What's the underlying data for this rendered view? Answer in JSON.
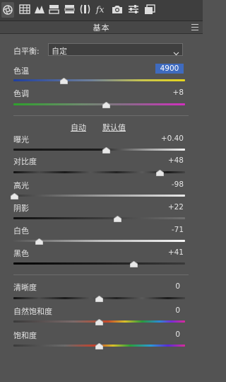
{
  "toolbar": {
    "icons": [
      "aperture-icon",
      "grid-icon",
      "curve-icon",
      "split-panel-icon",
      "toning-icon",
      "lens-icon",
      "fx-icon",
      "camera-icon",
      "sliders-icon",
      "presets-icon"
    ]
  },
  "panel": {
    "title": "基本"
  },
  "white_balance": {
    "label": "白平衡:",
    "selected": "自定"
  },
  "temperature": {
    "label": "色温",
    "value": "4900"
  },
  "tint": {
    "label": "色调",
    "value": "+8"
  },
  "tone_links": {
    "auto": "自动",
    "default": "默认值"
  },
  "exposure": {
    "label": "曝光",
    "value": "+0.40"
  },
  "contrast": {
    "label": "对比度",
    "value": "+48"
  },
  "highlights": {
    "label": "高光",
    "value": "-98"
  },
  "shadows": {
    "label": "阴影",
    "value": "+22"
  },
  "whites": {
    "label": "白色",
    "value": "-71"
  },
  "blacks": {
    "label": "黑色",
    "value": "+41"
  },
  "clarity": {
    "label": "清晰度",
    "value": "0"
  },
  "vibrance": {
    "label": "自然饱和度",
    "value": "0"
  },
  "saturation": {
    "label": "饱和度",
    "value": "0"
  },
  "colors": {
    "background": "#535353",
    "toolbar": "#3e3e3e",
    "selection": "#3f6bbf",
    "text": "#e6e6e6"
  }
}
